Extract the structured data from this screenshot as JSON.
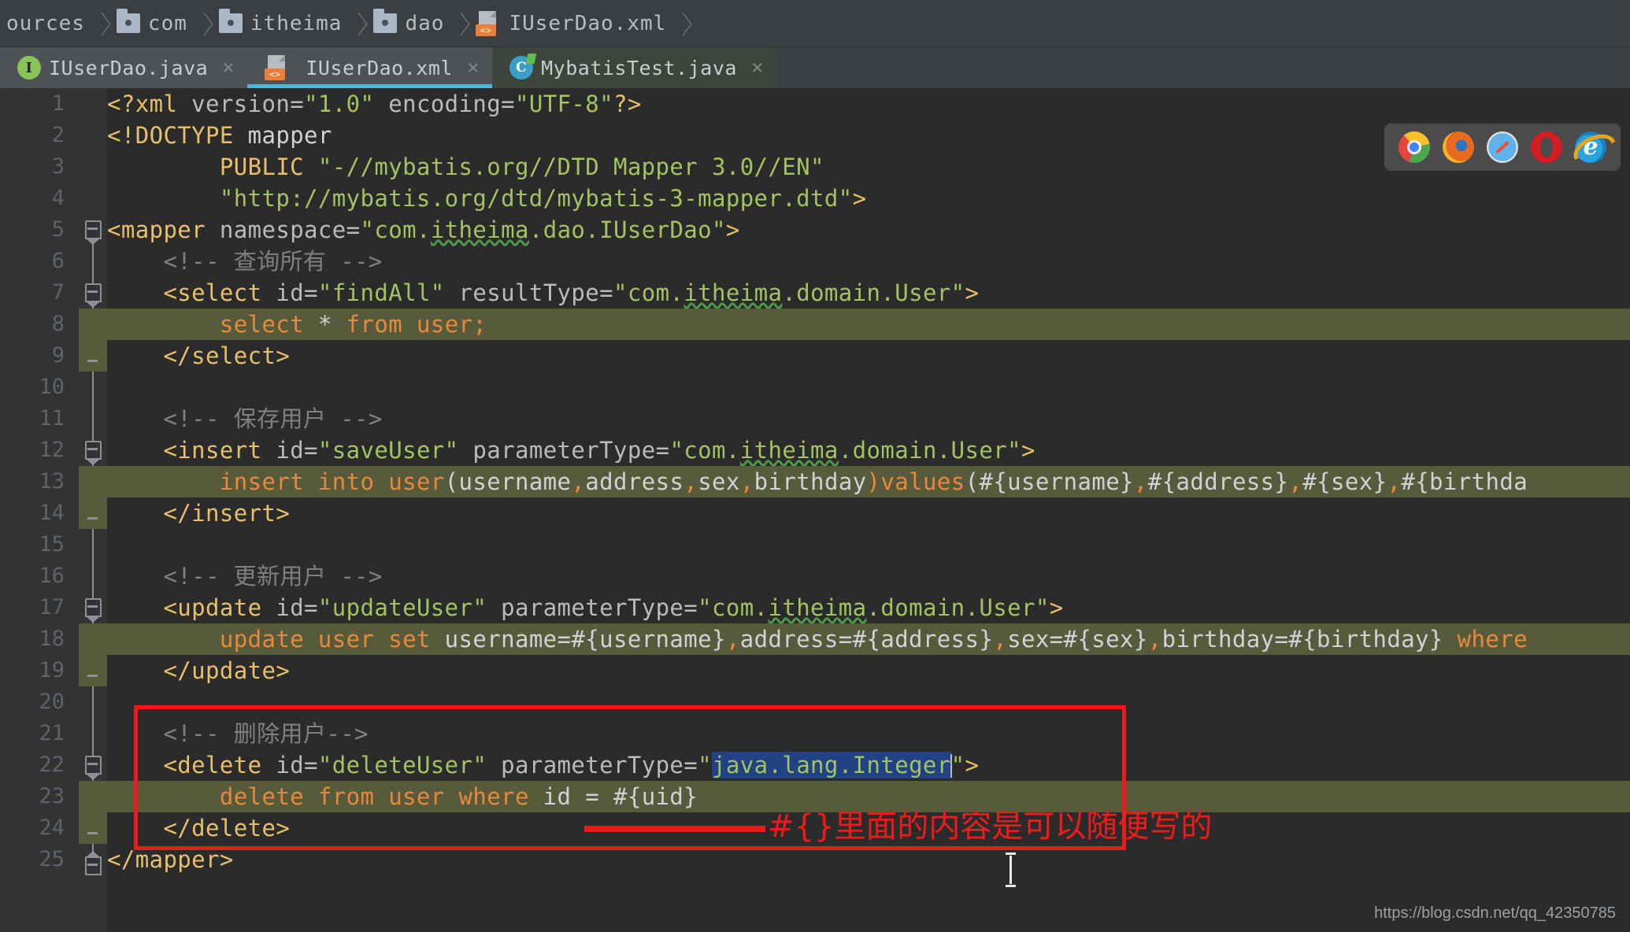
{
  "breadcrumb": {
    "items": [
      {
        "label": "ources",
        "icon": ""
      },
      {
        "label": "com",
        "icon": "folder-icon"
      },
      {
        "label": "itheima",
        "icon": "folder-icon"
      },
      {
        "label": "dao",
        "icon": "folder-icon"
      },
      {
        "label": "IUserDao.xml",
        "icon": "xml-file-icon"
      }
    ]
  },
  "tabs": [
    {
      "label": "IUserDao.java",
      "icon": "java-interface-icon",
      "active": false,
      "close": "×"
    },
    {
      "label": "IUserDao.xml",
      "icon": "xml-file-icon",
      "active": true,
      "close": "×"
    },
    {
      "label": "MybatisTest.java",
      "icon": "java-class-icon",
      "active": false,
      "close": "×"
    }
  ],
  "tab_icon_glyphs": {
    "java_interface": "I",
    "java_class": "C",
    "xml_tag": "<>"
  },
  "gutter": {
    "line_numbers": [
      "1",
      "2",
      "3",
      "4",
      "5",
      "6",
      "7",
      "8",
      "9",
      "10",
      "11",
      "12",
      "13",
      "14",
      "15",
      "16",
      "17",
      "18",
      "19",
      "20",
      "21",
      "22",
      "23",
      "24",
      "25"
    ]
  },
  "code": {
    "lines": [
      {
        "n": 1,
        "text": "<?xml version=\"1.0\" encoding=\"UTF-8\"?>"
      },
      {
        "n": 2,
        "text": "<!DOCTYPE mapper"
      },
      {
        "n": 3,
        "text": "        PUBLIC \"-//mybatis.org//DTD Mapper 3.0//EN\""
      },
      {
        "n": 4,
        "text": "        \"http://mybatis.org/dtd/mybatis-3-mapper.dtd\">"
      },
      {
        "n": 5,
        "text": "<mapper namespace=\"com.itheima.dao.IUserDao\">"
      },
      {
        "n": 6,
        "text": "    <!-- 查询所有 -->"
      },
      {
        "n": 7,
        "text": "    <select id=\"findAll\" resultType=\"com.itheima.domain.User\">"
      },
      {
        "n": 8,
        "text": "        select * from user;"
      },
      {
        "n": 9,
        "text": "    </select>"
      },
      {
        "n": 10,
        "text": ""
      },
      {
        "n": 11,
        "text": "    <!-- 保存用户 -->"
      },
      {
        "n": 12,
        "text": "    <insert id=\"saveUser\" parameterType=\"com.itheima.domain.User\">"
      },
      {
        "n": 13,
        "text": "        insert into user(username,address,sex,birthday)values(#{username},#{address},#{sex},#{birthda"
      },
      {
        "n": 14,
        "text": "    </insert>"
      },
      {
        "n": 15,
        "text": ""
      },
      {
        "n": 16,
        "text": "    <!-- 更新用户 -->"
      },
      {
        "n": 17,
        "text": "    <update id=\"updateUser\" parameterType=\"com.itheima.domain.User\">"
      },
      {
        "n": 18,
        "text": "        update user set username=#{username},address=#{address},sex=#{sex},birthday=#{birthday} where"
      },
      {
        "n": 19,
        "text": "    </update>"
      },
      {
        "n": 20,
        "text": ""
      },
      {
        "n": 21,
        "text": "    <!-- 删除用户-->"
      },
      {
        "n": 22,
        "text": "    <delete id=\"deleteUser\" parameterType=\"java.lang.Integer\">"
      },
      {
        "n": 23,
        "text": "        delete from user where id = #{uid}"
      },
      {
        "n": 24,
        "text": "    </delete>"
      },
      {
        "n": 25,
        "text": "</mapper>"
      }
    ],
    "segments": {
      "l1": {
        "a": "<?xml",
        "b": " version=",
        "c": "\"1.0\"",
        "d": " encoding=",
        "e": "\"UTF-8\"",
        "f": "?>"
      },
      "l2": {
        "a": "<!DOCTYPE",
        "b": " mapper"
      },
      "l3": {
        "a": "        PUBLIC ",
        "b": "\"-//mybatis.org//DTD Mapper 3.0//EN\""
      },
      "l4": {
        "a": "        ",
        "b": "\"http://mybatis.org/dtd/mybatis-3-mapper.dtd\"",
        "c": ">"
      },
      "l5": {
        "a": "<mapper",
        "b": " namespace=",
        "c": "\"com.",
        "d": "itheima",
        "e": ".dao.IUserDao\"",
        "f": ">"
      },
      "l6": {
        "a": "    <!-- 查询所有 -->"
      },
      "l7": {
        "a": "    <select",
        "b": " id=",
        "c": "\"findAll\"",
        "d": " resultType=",
        "e": "\"com.",
        "f": "itheima",
        "g": ".domain.User\"",
        "h": ">"
      },
      "l8": {
        "a": "        ",
        "b": "select",
        "c": " * ",
        "d": "from",
        "e": " user;"
      },
      "l9": {
        "a": "    </select>"
      },
      "l11": {
        "a": "    <!-- 保存用户 -->"
      },
      "l12": {
        "a": "    <insert",
        "b": " id=",
        "c": "\"saveUser\"",
        "d": " parameterType=",
        "e": "\"com.",
        "f": "itheima",
        "g": ".domain.User\"",
        "h": ">"
      },
      "l13": {
        "a": "        ",
        "b": "insert into user",
        "c": "(username",
        "d": ",",
        "e": "address",
        "f": ",",
        "g": "sex",
        "h": ",",
        "i": "birthday",
        "j": ")",
        "k": "values",
        "l": "(#{username}",
        "m": ",",
        "n": "#{address}",
        "o": ",",
        "p": "#{sex}",
        "q": ",",
        "r": "#{birthda"
      },
      "l14": {
        "a": "    </insert>"
      },
      "l16": {
        "a": "    <!-- 更新用户 -->"
      },
      "l17": {
        "a": "    <update",
        "b": " id=",
        "c": "\"updateUser\"",
        "d": " parameterType=",
        "e": "\"com.",
        "f": "itheima",
        "g": ".domain.User\"",
        "h": ">"
      },
      "l18": {
        "a": "        ",
        "b": "update user set",
        "c": " username=#{username}",
        "d": ",",
        "e": "address=#{address}",
        "f": ",",
        "g": "sex=#{sex}",
        "h": ",",
        "i": "birthday=#{birthday} ",
        "j": "where"
      },
      "l19": {
        "a": "    </update>"
      },
      "l21": {
        "a": "    <!-- 删除用户-->"
      },
      "l22": {
        "a": "    <delete",
        "b": " id=",
        "c": "\"deleteUser\"",
        "d": " parameterType=",
        "e": "\"",
        "f": "java.lang.Integer",
        "g": "\"",
        "h": ">"
      },
      "l23": {
        "a": "        ",
        "b": "delete from user where",
        "c": " id = #{uid}"
      },
      "l24": {
        "a": "    </delete>"
      },
      "l25": {
        "a": "</mapper>"
      }
    }
  },
  "selection": {
    "text": "java.lang.Integer",
    "background": "#214283",
    "foreground": "#a5c261"
  },
  "browser_bar": {
    "icons": [
      {
        "name": "chrome-icon",
        "label": "Chrome"
      },
      {
        "name": "firefox-icon",
        "label": "Firefox"
      },
      {
        "name": "safari-icon",
        "label": "Safari"
      },
      {
        "name": "opera-icon",
        "label": "Opera"
      },
      {
        "name": "internet-explorer-icon",
        "label": "e"
      }
    ]
  },
  "annotation": {
    "text": "#{}里面的内容是可以随便写的",
    "color": "#ee1b1b"
  },
  "watermark": {
    "text": "https://blog.csdn.net/qq_42350785"
  },
  "colors": {
    "editor_bg": "#2b2b2b",
    "gutter_bg": "#313335",
    "chrome_bg": "#3c3f41",
    "tab_active_bg": "#4e5254",
    "tab_underline": "#4ab8d8",
    "sql_region_bg": "#585a3c",
    "tag": "#e8bf6a",
    "string": "#a5c261",
    "comment": "#808080",
    "sql_keyword": "#e8883a",
    "text": "#a9b7c6"
  }
}
